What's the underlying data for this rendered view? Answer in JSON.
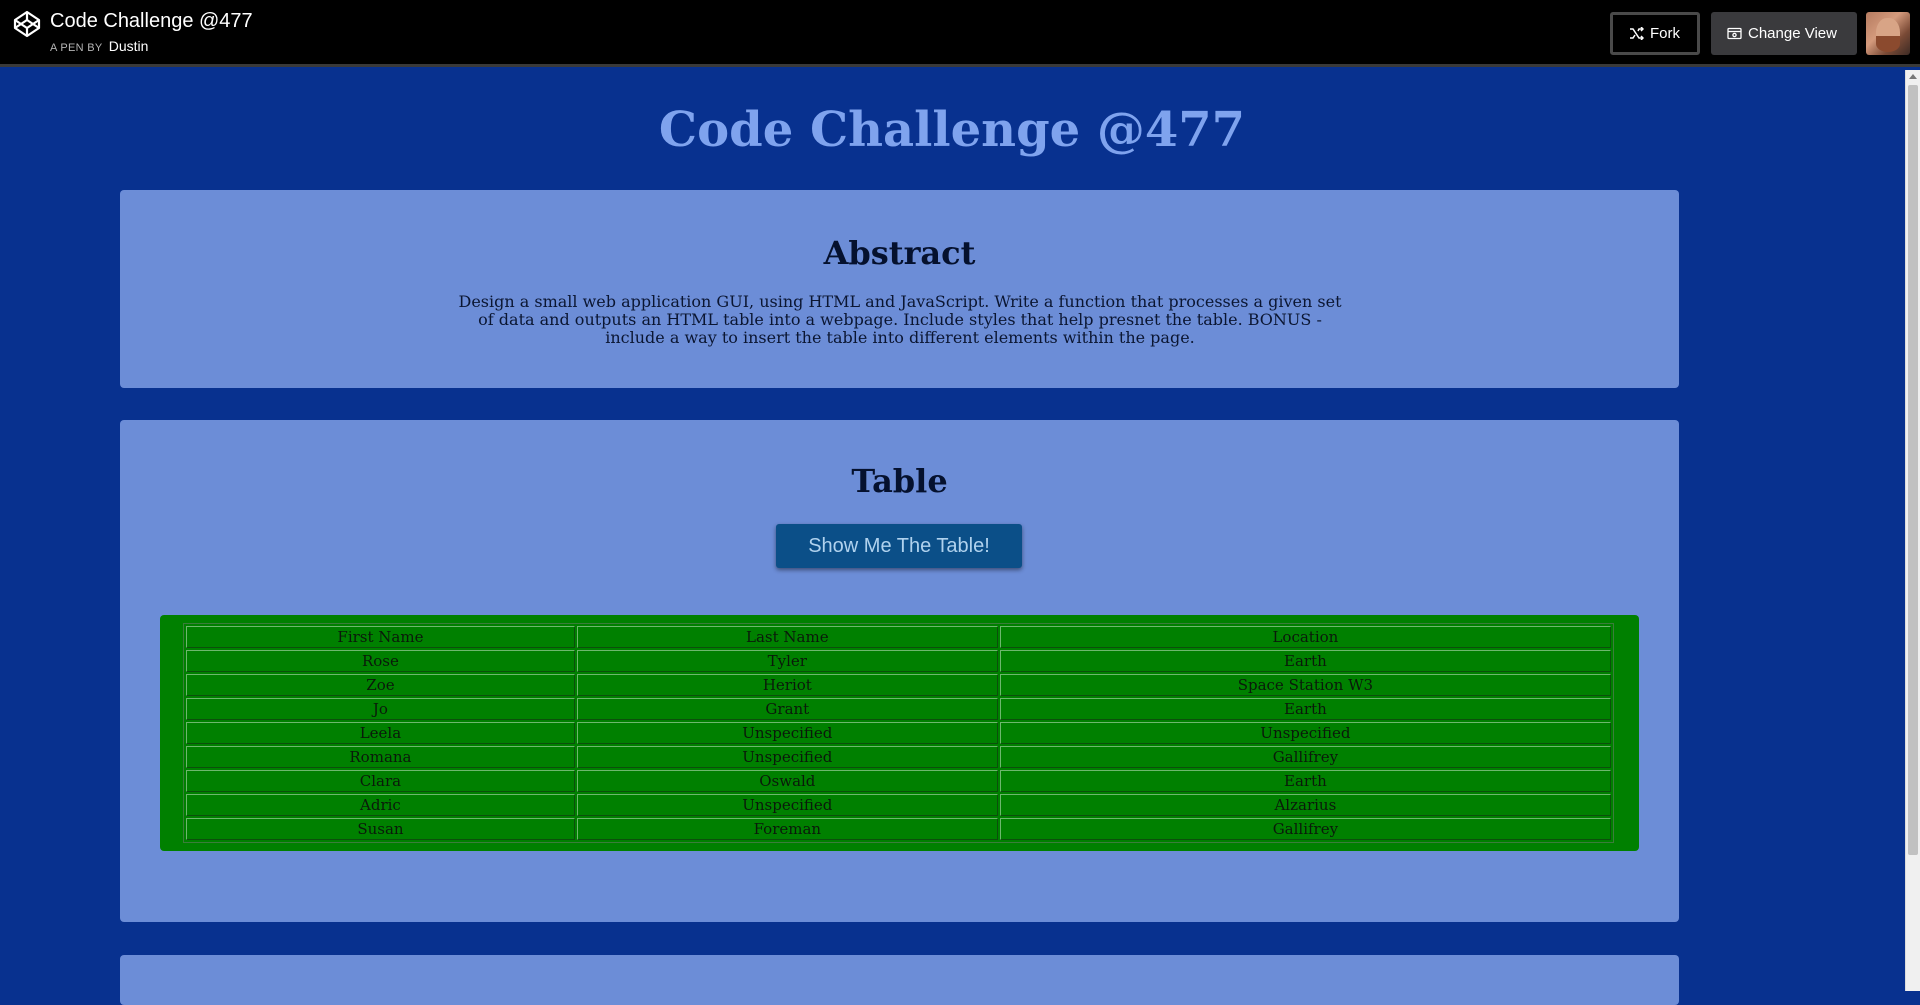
{
  "header": {
    "title": "Code Challenge @477",
    "byline_prefix": "A PEN BY",
    "author": "Dustin",
    "fork_label": "Fork",
    "change_view_label": "Change View"
  },
  "page": {
    "title": "Code Challenge @477"
  },
  "abstract": {
    "heading": "Abstract",
    "text": "Design a small web application GUI, using HTML and JavaScript. Write a function that processes a given set of data and outputs an HTML table into a webpage. Include styles that help presnet the table. BONUS - include a way to insert the table into different elements within the page."
  },
  "table_section": {
    "heading": "Table",
    "button_label": "Show Me The Table!",
    "columns": [
      "First Name",
      "Last Name",
      "Location"
    ],
    "rows": [
      [
        "Rose",
        "Tyler",
        "Earth"
      ],
      [
        "Zoe",
        "Heriot",
        "Space Station W3"
      ],
      [
        "Jo",
        "Grant",
        "Earth"
      ],
      [
        "Leela",
        "Unspecified",
        "Unspecified"
      ],
      [
        "Romana",
        "Unspecified",
        "Gallifrey"
      ],
      [
        "Clara",
        "Oswald",
        "Earth"
      ],
      [
        "Adric",
        "Unspecified",
        "Alzarius"
      ],
      [
        "Susan",
        "Foreman",
        "Gallifrey"
      ]
    ]
  },
  "colors": {
    "background": "#08318f",
    "panel": "#6c8dd7",
    "title": "#7fa3ee",
    "table_bg": "#008000",
    "button_bg": "#0b4f88"
  },
  "icons": {
    "logo": "codepen-logo-icon",
    "fork": "fork-icon",
    "change_view": "change-view-icon"
  }
}
